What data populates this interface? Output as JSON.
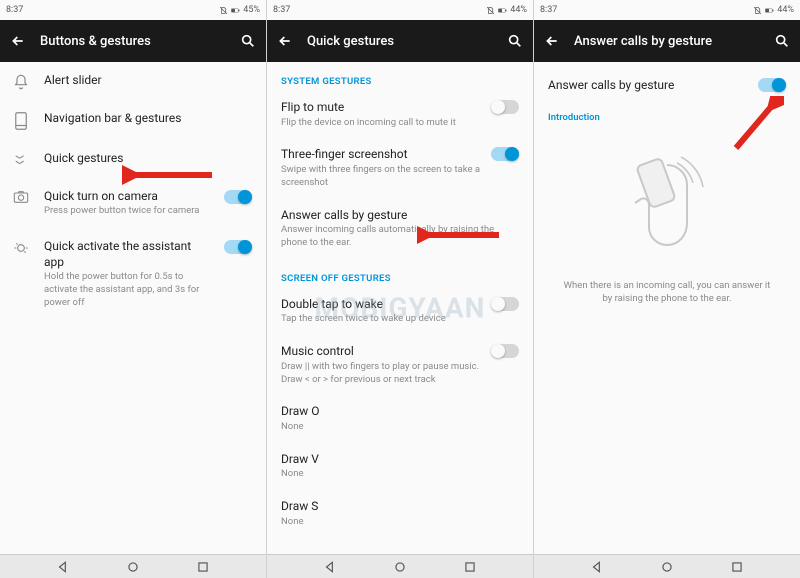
{
  "screens": [
    {
      "time": "8:37",
      "battery": "45%",
      "title": "Buttons & gestures",
      "items": [
        {
          "label": "Alert slider"
        },
        {
          "label": "Navigation bar & gestures"
        },
        {
          "label": "Quick gestures"
        },
        {
          "label": "Quick turn on camera",
          "sub": "Press power button twice for camera",
          "toggle": "on"
        },
        {
          "label": "Quick activate the assistant app",
          "sub": "Hold the power button for 0.5s to activate the assistant app, and 3s for power off",
          "toggle": "on"
        }
      ]
    },
    {
      "time": "8:37",
      "battery": "44%",
      "title": "Quick gestures",
      "sections": {
        "system": "SYSTEM GESTURES",
        "screenoff": "SCREEN OFF GESTURES"
      },
      "system_items": [
        {
          "label": "Flip to mute",
          "sub": "Flip the device on incoming call to mute it",
          "toggle": "off"
        },
        {
          "label": "Three-finger screenshot",
          "sub": "Swipe with three fingers on the screen to take a screenshot",
          "toggle": "on"
        },
        {
          "label": "Answer calls by gesture",
          "sub": "Answer incoming calls automatically by raising the phone to the ear."
        }
      ],
      "screenoff_items": [
        {
          "label": "Double tap to wake",
          "sub": "Tap the screen twice to wake up device",
          "toggle": "off"
        },
        {
          "label": "Music control",
          "sub": "Draw || with two fingers to play or pause music. Draw < or > for previous or next track",
          "toggle": "off"
        },
        {
          "label": "Draw O",
          "sub": "None"
        },
        {
          "label": "Draw V",
          "sub": "None"
        },
        {
          "label": "Draw S",
          "sub": "None"
        }
      ]
    },
    {
      "time": "8:37",
      "battery": "44%",
      "title": "Answer calls by gesture",
      "toggle_label": "Answer calls by gesture",
      "toggle": "on",
      "intro": "Introduction",
      "desc": "When there is an incoming call, you can answer it by raising the phone to the ear."
    }
  ],
  "watermark": "MOBIGYAAN"
}
